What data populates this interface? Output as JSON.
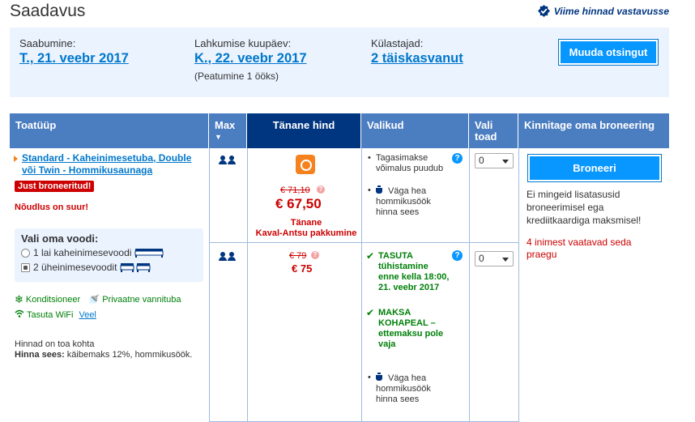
{
  "header": {
    "title": "Saadavus",
    "price_guarantee": "Viime hinnad vastavusse"
  },
  "search": {
    "checkin_label": "Saabumine:",
    "checkin_value": "T., 21. veebr 2017",
    "checkout_label": "Lahkumise kuupäev:",
    "checkout_value": "K., 22. veebr 2017",
    "stay_note": "(Peatumine 1 ööks)",
    "guests_label": "Külastajad:",
    "guests_value": "2 täiskasvanut",
    "modify_button": "Muuda otsingut"
  },
  "table": {
    "headers": {
      "room_type": "Toatüüp",
      "max": "Max",
      "price": "Tänane hind",
      "options": "Valikud",
      "qty": "Vali toad",
      "confirm": "Kinnitage oma broneering"
    },
    "room": {
      "name": "Standard - Kaheinimesetuba, Double või Twin - Hommikusaunaga",
      "just_booked": "Just broneeritud!",
      "high_demand": "Nõudlus on suur!",
      "bed_choice_title": "Vali oma voodi:",
      "bed_options": [
        "1 lai kaheinimesevoodi",
        "2 üheinimesevoodit"
      ],
      "amenities": [
        "Konditsioneer",
        "Privaatne vannituba",
        "Tasuta WiFi"
      ],
      "amenities_more": "Veel",
      "price_note_line1": "Hinnad on toa kohta",
      "price_note_bold": "Hinna sees:",
      "price_note_rest": " käibemaks 12%, hommikusöök."
    },
    "rates": [
      {
        "old_price": "€ 71,10",
        "price": "€ 67,50",
        "deal_line1": "Tänane",
        "deal_line2": "Kaval-Antsu pakkumine",
        "options": [
          "Tagasimakse võimalus puudub",
          "Väga hea hommikusöök hinna sees"
        ],
        "qty": "0"
      },
      {
        "old_price": "€ 79",
        "price": "€ 75",
        "options": [
          "TASUTA tühistamine enne kella 18:00, 21. veebr 2017",
          "MAKSA KOHAPEAL – ettemaksu pole vaja",
          "Väga hea hommikusöök hinna sees"
        ],
        "qty": "0"
      }
    ],
    "book_button": "Broneeri",
    "book_note": "Ei mingeid lisatasusid broneerimisel ega krediitkaardiga maksmisel!",
    "viewers": "4 inimest vaatavad seda praegu"
  }
}
